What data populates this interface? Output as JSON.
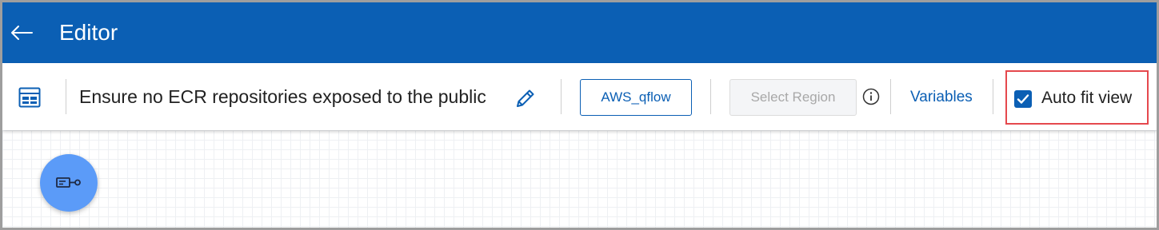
{
  "header": {
    "title": "Editor",
    "back_icon": "arrow-left-icon",
    "background": "#0b5fb4"
  },
  "toolbar": {
    "layout_icon": "layout-panel-icon",
    "flow_title": "Ensure no ECR repositories exposed to the public",
    "edit_icon": "pencil-icon",
    "account_button": "AWS_qflow",
    "region_button": "Select Region",
    "region_disabled": true,
    "info_icon": "info-icon",
    "variables_link": "Variables",
    "auto_fit_label": "Auto fit view",
    "auto_fit_checked": true,
    "accent": "#0b5fb4",
    "highlight": "#e5484d"
  },
  "canvas": {
    "start_node_icon": "trigger-node-icon",
    "node_color": "#5b9bf8"
  }
}
